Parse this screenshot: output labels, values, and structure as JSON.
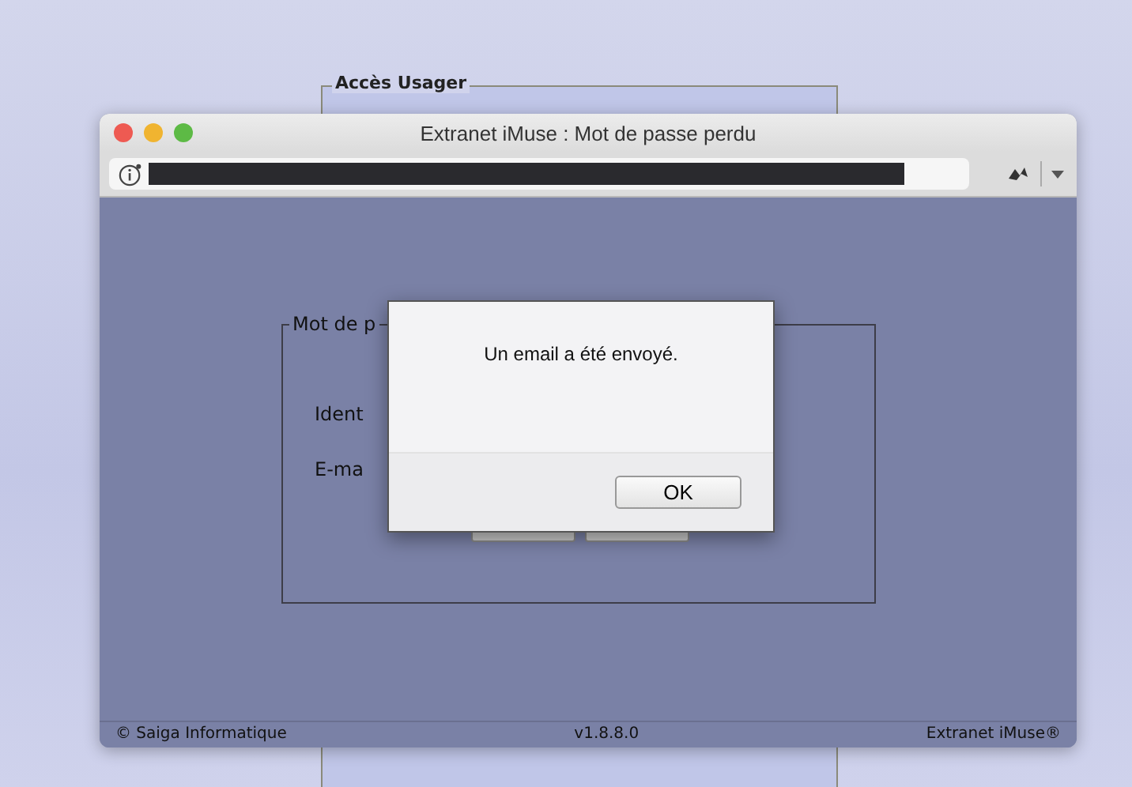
{
  "background_panel": {
    "legend": "Accès Usager"
  },
  "window": {
    "title": "Extranet iMuse : Mot de passe perdu"
  },
  "form": {
    "legend": "Mot de p",
    "labels": [
      "Ident",
      "E-ma"
    ]
  },
  "dialog": {
    "message": "Un email a été envoyé.",
    "button": "OK"
  },
  "status_bar": {
    "left": "© Saiga Informatique",
    "center": "v1.8.8.0",
    "right": "Extranet iMuse®"
  }
}
